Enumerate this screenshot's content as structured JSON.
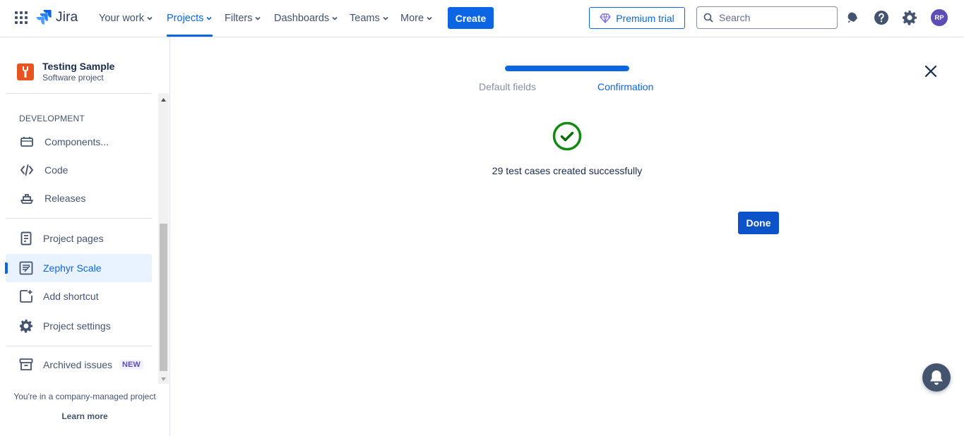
{
  "topnav": {
    "app_name": "Jira",
    "items": [
      {
        "label": "Your work"
      },
      {
        "label": "Projects"
      },
      {
        "label": "Filters"
      },
      {
        "label": "Dashboards"
      },
      {
        "label": "Teams"
      },
      {
        "label": "More"
      }
    ],
    "active_item": "Projects",
    "create_label": "Create",
    "premium_label": "Premium trial",
    "search_placeholder": "Search",
    "avatar_initials": "RP",
    "icons": [
      "app-switcher-icon",
      "jira-logo-icon",
      "diamond-icon",
      "search-icon",
      "notifications-icon",
      "help-icon",
      "settings-icon"
    ]
  },
  "sidebar": {
    "project_name": "Testing Sample",
    "project_type": "Software project",
    "section_heading": "DEVELOPMENT",
    "dev_items": [
      {
        "label": "Components...",
        "icon": "components-icon"
      },
      {
        "label": "Code",
        "icon": "code-icon"
      },
      {
        "label": "Releases",
        "icon": "releases-icon"
      }
    ],
    "items": [
      {
        "label": "Project pages",
        "icon": "page-icon"
      },
      {
        "label": "Zephyr Scale",
        "icon": "zephyr-icon",
        "selected": true
      },
      {
        "label": "Add shortcut",
        "icon": "add-shortcut-icon"
      },
      {
        "label": "Project settings",
        "icon": "gear-icon"
      }
    ],
    "archived_label": "Archived issues",
    "archived_badge": "NEW",
    "footer_text": "You're in a company-managed project",
    "learn_more": "Learn more"
  },
  "wizard": {
    "steps": [
      {
        "label": "Default fields",
        "state": "done"
      },
      {
        "label": "Confirmation",
        "state": "current"
      }
    ],
    "progress_fraction": 1.0,
    "success_message": "29 test cases created successfully",
    "done_label": "Done"
  },
  "colors": {
    "brand_blue": "#0c66e4",
    "success_green": "#1f845a",
    "project_avatar": "#e8541f",
    "avatar_purple": "#5e4db2"
  }
}
